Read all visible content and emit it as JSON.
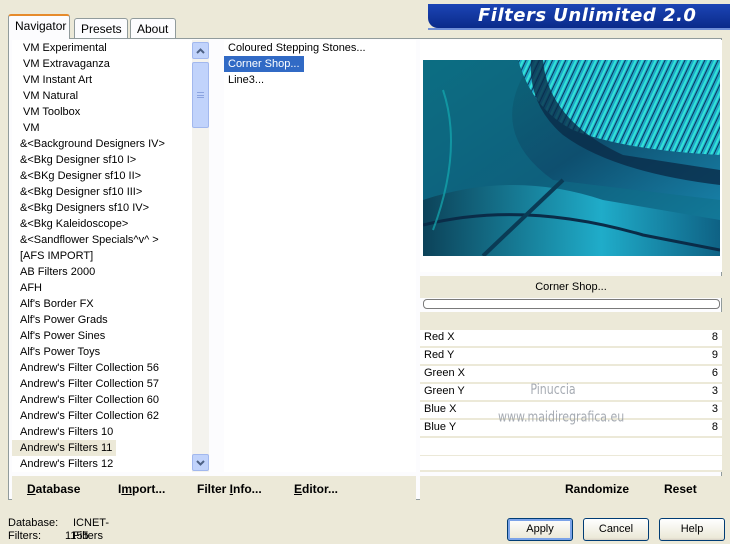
{
  "tabs": [
    "Navigator",
    "Presets",
    "About"
  ],
  "banner_title": "Filters Unlimited 2.0",
  "categories": [
    "VM Experimental",
    "VM Extravaganza",
    "VM Instant Art",
    "VM Natural",
    "VM Toolbox",
    "VM",
    "&<Background Designers IV>",
    "&<Bkg Designer sf10 I>",
    "&<BKg Designer sf10 II>",
    "&<Bkg Designer sf10 III>",
    "&<Bkg Designers sf10 IV>",
    "&<Bkg Kaleidoscope>",
    "&<Sandflower Specials^v^ >",
    "[AFS IMPORT]",
    "AB Filters 2000",
    "AFH",
    "Alf's Border FX",
    "Alf's Power Grads",
    "Alf's Power Sines",
    "Alf's Power Toys",
    "Andrew's Filter Collection 56",
    "Andrew's Filter Collection 57",
    "Andrew's Filter Collection 60",
    "Andrew's Filter Collection 62",
    "Andrew's Filters 10",
    "Andrew's Filters 11",
    "Andrew's Filters 12"
  ],
  "selected_category": "Andrew's Filters 11",
  "filters": [
    "Coloured Stepping Stones...",
    "Corner Shop...",
    "Line3..."
  ],
  "selected_filter": "Corner Shop...",
  "current_filter_label": "Corner Shop...",
  "params": [
    {
      "label": "Red X",
      "value": "8"
    },
    {
      "label": "Red Y",
      "value": "9"
    },
    {
      "label": "Green X",
      "value": "6"
    },
    {
      "label": "Green Y",
      "value": "3"
    },
    {
      "label": "Blue X",
      "value": "3"
    },
    {
      "label": "Blue Y",
      "value": "8"
    }
  ],
  "watermark": [
    "Pinuccia",
    "www.maidiregrafica.eu"
  ],
  "left_buttons": {
    "database": {
      "u": "D",
      "rest": "atabase"
    },
    "import": {
      "pre": "I",
      "u": "m",
      "rest": "port..."
    },
    "filter_info": {
      "pre": "Filter ",
      "u": "I",
      "rest": "nfo..."
    },
    "editor": {
      "u": "E",
      "rest": "ditor..."
    }
  },
  "right_buttons": {
    "randomize": "Randomize",
    "reset": "Reset"
  },
  "status": {
    "database_label": "Database:",
    "database_value": "ICNET-Filters",
    "filters_label": "Filters:",
    "filters_value": "1155"
  },
  "dialog_buttons": {
    "apply": "Apply",
    "cancel": "Cancel",
    "help": "Help"
  }
}
